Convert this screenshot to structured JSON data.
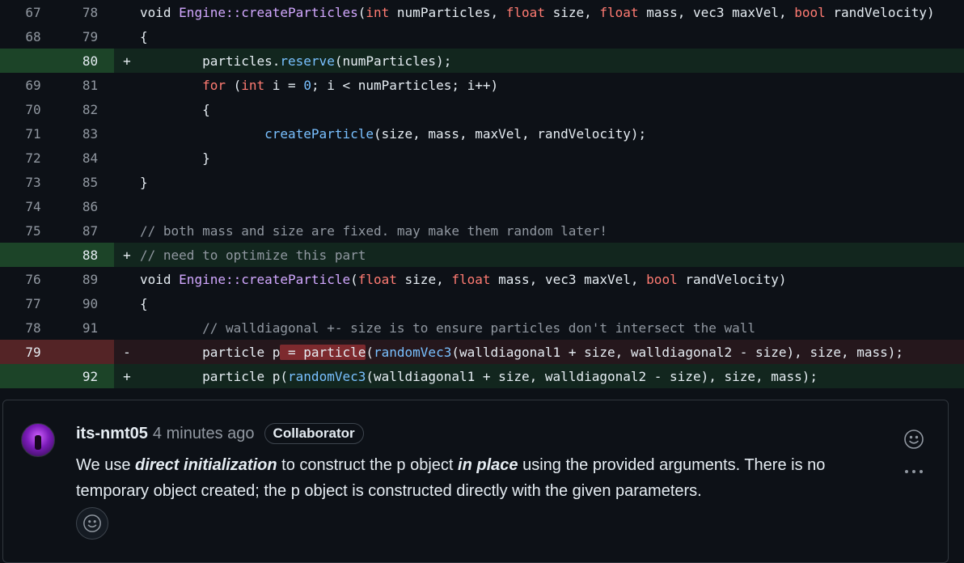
{
  "diff": {
    "lines": [
      {
        "type": "ctx",
        "old": "67",
        "new": "78",
        "marker": "",
        "segs": [
          [
            "",
            "void "
          ],
          [
            "fn",
            "Engine::createParticles"
          ],
          [
            "",
            "("
          ],
          [
            "kw",
            "int"
          ],
          [
            "",
            " numParticles, "
          ],
          [
            "kw",
            "float"
          ],
          [
            "",
            " size, "
          ],
          [
            "kw",
            "float"
          ],
          [
            "",
            " mass, vec3 maxVel, "
          ],
          [
            "kw",
            "bool"
          ],
          [
            "",
            " randVelocity)"
          ]
        ]
      },
      {
        "type": "ctx",
        "old": "68",
        "new": "79",
        "marker": "",
        "segs": [
          [
            "",
            "{"
          ]
        ]
      },
      {
        "type": "add",
        "old": "",
        "new": "80",
        "marker": "+",
        "segs": [
          [
            "",
            "        particles."
          ],
          [
            "m",
            "reserve"
          ],
          [
            "",
            "(numParticles);"
          ]
        ]
      },
      {
        "type": "ctx",
        "old": "69",
        "new": "81",
        "marker": "",
        "segs": [
          [
            "",
            "        "
          ],
          [
            "kw",
            "for"
          ],
          [
            "",
            " ("
          ],
          [
            "kw",
            "int"
          ],
          [
            "",
            " i = "
          ],
          [
            "m",
            "0"
          ],
          [
            "",
            "; i < numParticles; i++)"
          ]
        ]
      },
      {
        "type": "ctx",
        "old": "70",
        "new": "82",
        "marker": "",
        "segs": [
          [
            "",
            "        {"
          ]
        ]
      },
      {
        "type": "ctx",
        "old": "71",
        "new": "83",
        "marker": "",
        "segs": [
          [
            "",
            "                "
          ],
          [
            "m",
            "createParticle"
          ],
          [
            "",
            "(size, mass, maxVel, randVelocity);"
          ]
        ]
      },
      {
        "type": "ctx",
        "old": "72",
        "new": "84",
        "marker": "",
        "segs": [
          [
            "",
            "        }"
          ]
        ]
      },
      {
        "type": "ctx",
        "old": "73",
        "new": "85",
        "marker": "",
        "segs": [
          [
            "",
            "}"
          ]
        ]
      },
      {
        "type": "ctx",
        "old": "74",
        "new": "86",
        "marker": "",
        "segs": []
      },
      {
        "type": "ctx",
        "old": "75",
        "new": "87",
        "marker": "",
        "segs": [
          [
            "cm",
            "// both mass and size are fixed. may make them random later!"
          ]
        ]
      },
      {
        "type": "add",
        "old": "",
        "new": "88",
        "marker": "+",
        "segs": [
          [
            "cm",
            "// need to optimize this part"
          ]
        ]
      },
      {
        "type": "ctx",
        "old": "76",
        "new": "89",
        "marker": "",
        "segs": [
          [
            "",
            "void "
          ],
          [
            "fn",
            "Engine::createParticle"
          ],
          [
            "",
            "("
          ],
          [
            "kw",
            "float"
          ],
          [
            "",
            " size, "
          ],
          [
            "kw",
            "float"
          ],
          [
            "",
            " mass, vec3 maxVel, "
          ],
          [
            "kw",
            "bool"
          ],
          [
            "",
            " randVelocity)"
          ]
        ]
      },
      {
        "type": "ctx",
        "old": "77",
        "new": "90",
        "marker": "",
        "segs": [
          [
            "",
            "{"
          ]
        ]
      },
      {
        "type": "ctx",
        "old": "78",
        "new": "91",
        "marker": "",
        "segs": [
          [
            "cm",
            "        // walldiagonal +- size is to ensure particles don't intersect the wall"
          ]
        ]
      },
      {
        "type": "del",
        "old": "79",
        "new": "",
        "marker": "-",
        "segs": [
          [
            "",
            "        particle p"
          ],
          [
            "hl-del",
            " = particle"
          ],
          [
            "",
            "("
          ],
          [
            "m",
            "randomVec3"
          ],
          [
            "",
            "(walldiagonal1 + size, walldiagonal2 - size), size, mass);"
          ]
        ]
      },
      {
        "type": "add",
        "old": "",
        "new": "92",
        "marker": "+",
        "segs": [
          [
            "",
            "        particle p("
          ],
          [
            "m",
            "randomVec3"
          ],
          [
            "",
            "(walldiagonal1 + size, walldiagonal2 - size), size, mass);"
          ]
        ]
      }
    ]
  },
  "comment": {
    "author": "its-nmt05",
    "time": "4 minutes ago",
    "badge": "Collaborator",
    "body": [
      {
        "t": "We use ",
        "em": false
      },
      {
        "t": "direct initialization",
        "em": true
      },
      {
        "t": " to construct the p object ",
        "em": false
      },
      {
        "t": "in place",
        "em": true
      },
      {
        "t": " using the provided arguments. There is no temporary object created; the p object is constructed directly with the given parameters.",
        "em": false
      }
    ],
    "icons": {
      "avatar": "avatar",
      "reaction": "smiley-icon",
      "more": "kebab-horizontal-icon"
    }
  },
  "colors": {
    "added_bg": "#12261e",
    "deleted_bg": "#25171c",
    "keyword": "#ff7b72",
    "function": "#d2a8ff",
    "constant": "#79c0ff"
  }
}
